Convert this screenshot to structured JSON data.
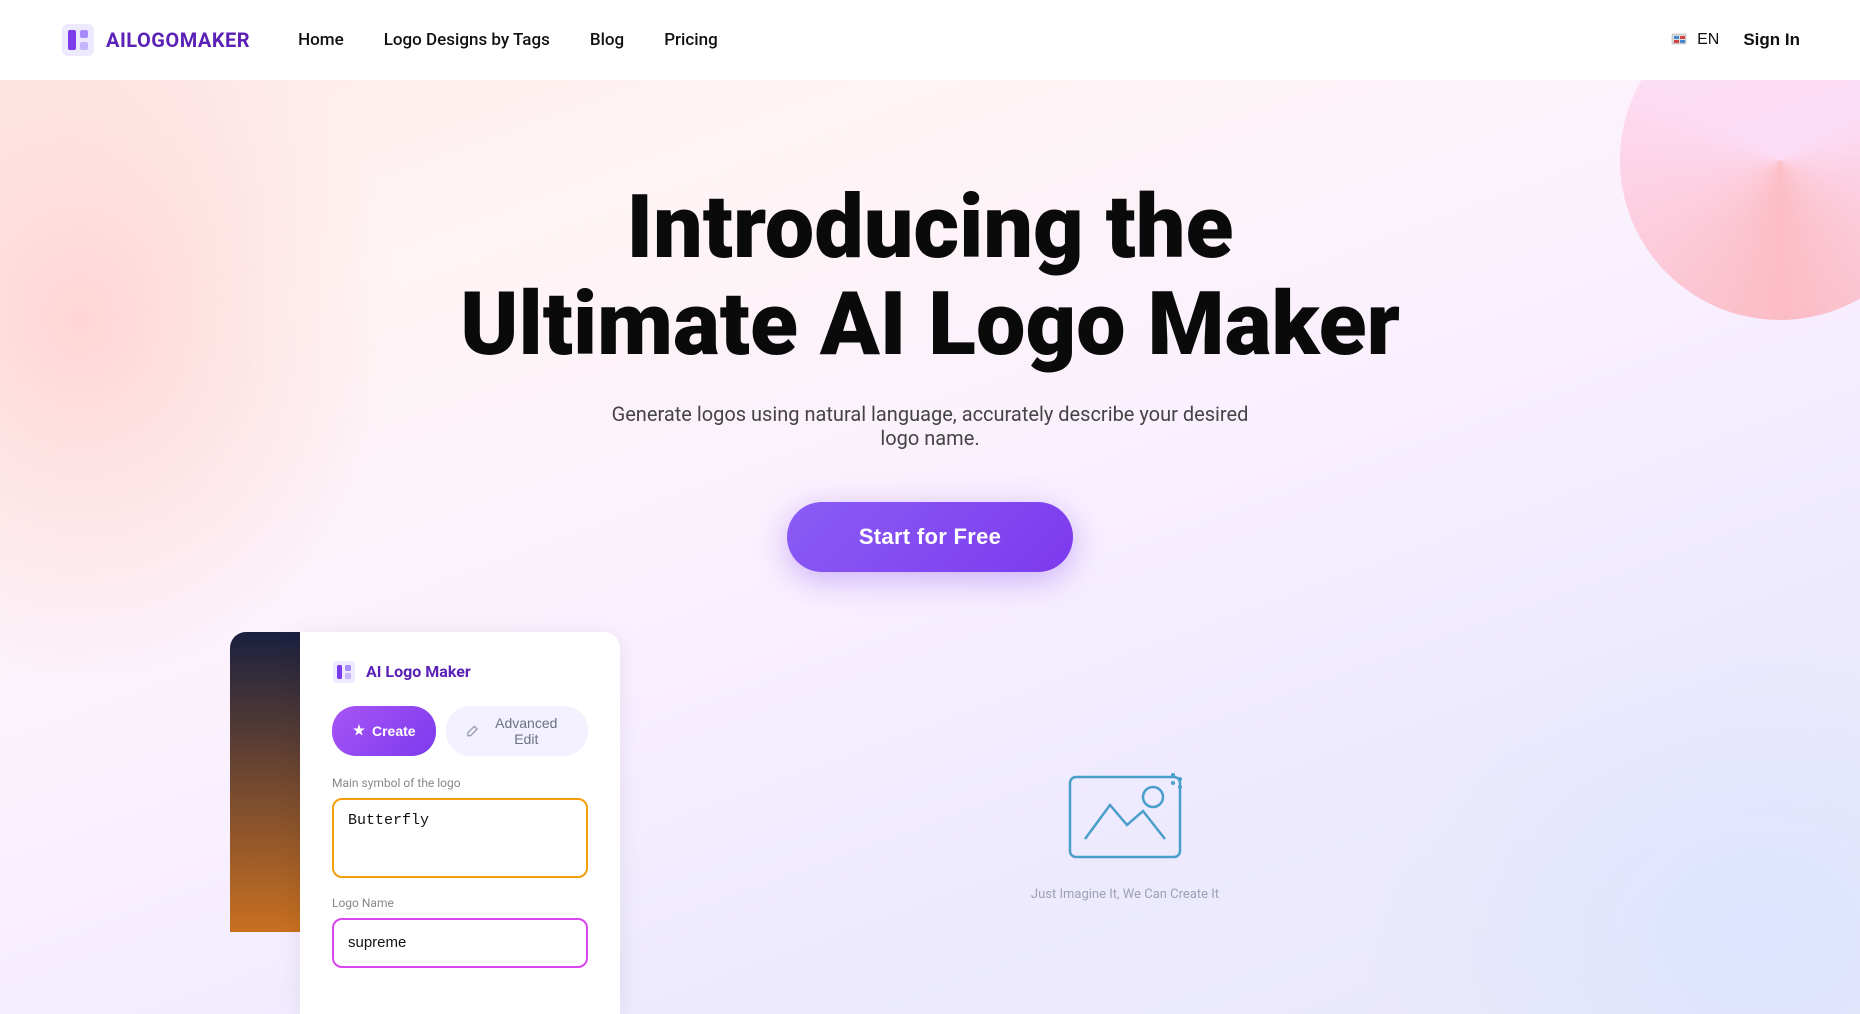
{
  "navbar": {
    "logo_text": "AILOGOMAKER",
    "links": [
      {
        "label": "Home",
        "id": "home"
      },
      {
        "label": "Logo Designs by Tags",
        "id": "logo-designs"
      },
      {
        "label": "Blog",
        "id": "blog"
      },
      {
        "label": "Pricing",
        "id": "pricing"
      }
    ],
    "lang_label": "EN",
    "sign_in_label": "Sign In"
  },
  "hero": {
    "title_line1": "Introducing the",
    "title_line2": "Ultimate AI Logo Maker",
    "subtitle": "Generate logos using natural language, accurately describe your desired logo name.",
    "cta_label": "Start for Free"
  },
  "app_card": {
    "title": "AI Logo Maker",
    "tab_create": "Create",
    "tab_advanced": "Advanced Edit",
    "field_symbol_label": "Main symbol of the logo",
    "field_symbol_value": "Butterfly",
    "field_name_label": "Logo Name",
    "field_name_value": "supreme"
  },
  "preview_right": {
    "bottom_label": "Just Imagine It, We Can Create It"
  }
}
